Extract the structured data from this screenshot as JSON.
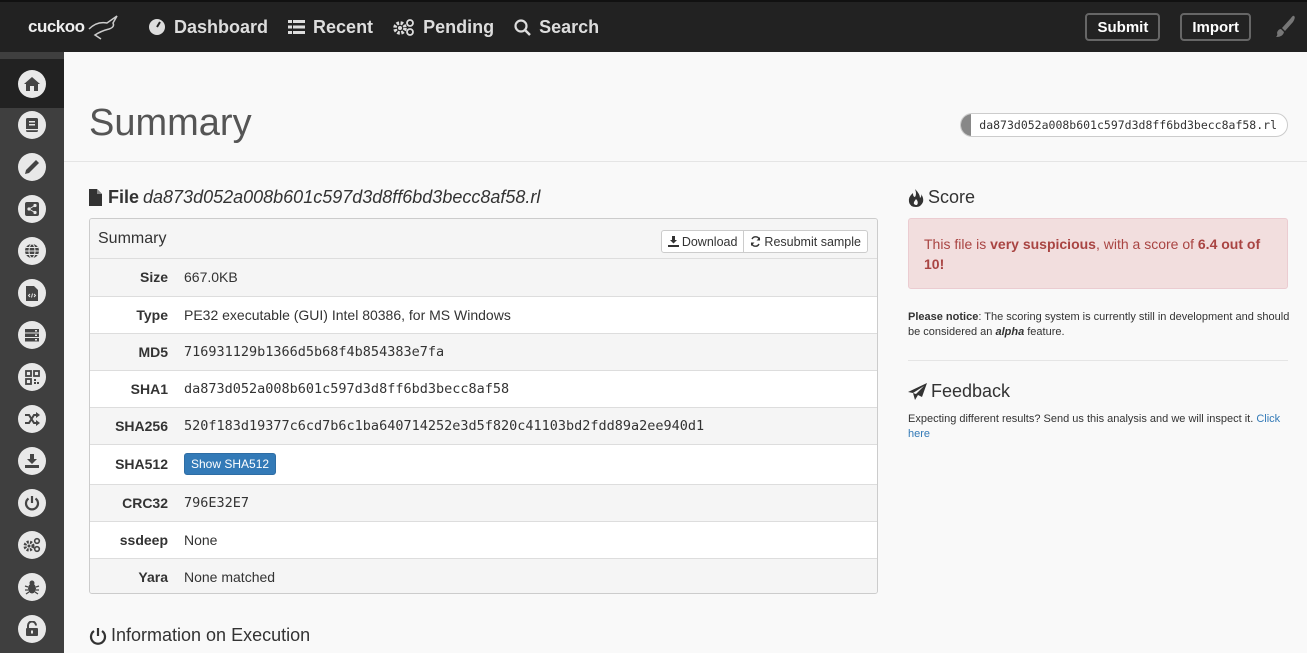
{
  "app": {
    "logo_text": "cuckoo"
  },
  "nav": {
    "items": [
      {
        "label": "Dashboard",
        "icon": "dashboard-icon"
      },
      {
        "label": "Recent",
        "icon": "list-icon"
      },
      {
        "label": "Pending",
        "icon": "gears-icon"
      },
      {
        "label": "Search",
        "icon": "search-icon"
      }
    ],
    "submit_label": "Submit",
    "import_label": "Import",
    "theme_icon": "paintbrush-icon"
  },
  "sidebar": {
    "items": [
      {
        "name": "summary",
        "icon": "home-icon",
        "active": true
      },
      {
        "name": "static-analysis",
        "icon": "book-icon"
      },
      {
        "name": "extracted-artifacts",
        "icon": "pencil-icon"
      },
      {
        "name": "behavioral-analysis",
        "icon": "share-icon"
      },
      {
        "name": "network-analysis",
        "icon": "globe-icon"
      },
      {
        "name": "dropped-files",
        "icon": "file-code-icon"
      },
      {
        "name": "dropped-buffers",
        "icon": "server-icon"
      },
      {
        "name": "process-memory",
        "icon": "qrcode-icon"
      },
      {
        "name": "compare-analysis",
        "icon": "shuffle-icon"
      },
      {
        "name": "export-analysis",
        "icon": "download-icon"
      },
      {
        "name": "reboot-analysis",
        "icon": "power-icon"
      },
      {
        "name": "options",
        "icon": "cogs-icon"
      },
      {
        "name": "misp",
        "icon": "bug-icon"
      },
      {
        "name": "unlock",
        "icon": "unlock-icon"
      }
    ]
  },
  "header": {
    "title": "Summary",
    "hash_pill": "da873d052a008b601c597d3d8ff6bd3becc8af58.rl"
  },
  "file": {
    "label": "File",
    "name": "da873d052a008b601c597d3d8ff6bd3becc8af58.rl",
    "panel_title": "Summary",
    "download_label": "Download",
    "resubmit_label": "Resubmit sample",
    "rows": [
      {
        "key": "Size",
        "value": "667.0KB"
      },
      {
        "key": "Type",
        "value": "PE32 executable (GUI) Intel 80386, for MS Windows"
      },
      {
        "key": "MD5",
        "value": "716931129b1366d5b68f4b854383e7fa"
      },
      {
        "key": "SHA1",
        "value": "da873d052a008b601c597d3d8ff6bd3becc8af58"
      },
      {
        "key": "SHA256",
        "value": "520f183d19377c6cd7b6c1ba640714252e3d5f820c41103bd2fdd89a2ee940d1"
      },
      {
        "key": "SHA512",
        "button": "Show SHA512"
      },
      {
        "key": "CRC32",
        "value": "796E32E7"
      },
      {
        "key": "ssdeep",
        "value": "None"
      },
      {
        "key": "Yara",
        "value": "None matched"
      }
    ]
  },
  "execution": {
    "heading": "Information on Execution"
  },
  "score": {
    "heading": "Score",
    "text_prefix": "This file is ",
    "verdict": "very suspicious",
    "text_mid": ", with a score of ",
    "score_text": "6.4 out of 10!",
    "score_value": 6.4,
    "score_max": 10,
    "notice_label": "Please notice",
    "notice_text_1": ": The scoring system is currently still in development and should be considered an ",
    "notice_em": "alpha",
    "notice_text_2": " feature."
  },
  "feedback": {
    "heading": "Feedback",
    "text": "Expecting different results? Send us this analysis and we will inspect it. ",
    "link": "Click here"
  },
  "colors": {
    "topbar": "#222222",
    "sidebar": "#3f3f3f",
    "primary": "#337ab7",
    "danger_bg": "#f2dede",
    "danger_text": "#a94442"
  }
}
